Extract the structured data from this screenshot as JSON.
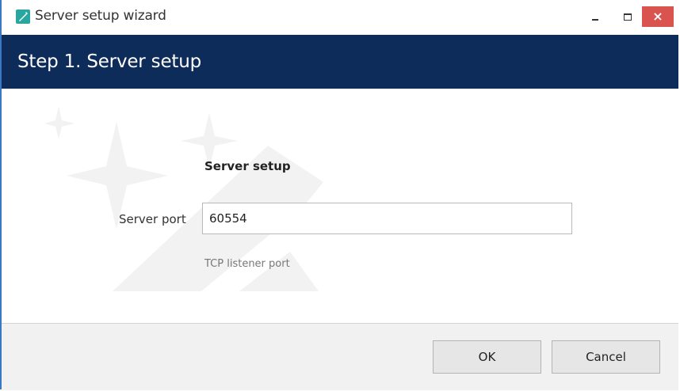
{
  "window": {
    "title": "Server setup wizard",
    "close_glyph": "×",
    "icons": {
      "app": "wizard-app-icon",
      "minimize": "minimize-icon",
      "maximize": "maximize-icon",
      "close": "close-icon"
    }
  },
  "header": {
    "title": "Step 1. Server setup",
    "background": "#0e2c5a"
  },
  "form": {
    "section_heading": "Server setup",
    "port_label": "Server port",
    "port_value": "60554",
    "port_hint": "TCP listener port"
  },
  "footer": {
    "ok_label": "OK",
    "cancel_label": "Cancel"
  },
  "colors": {
    "accent_border": "#3b78c4",
    "close_button": "#d9534f"
  }
}
